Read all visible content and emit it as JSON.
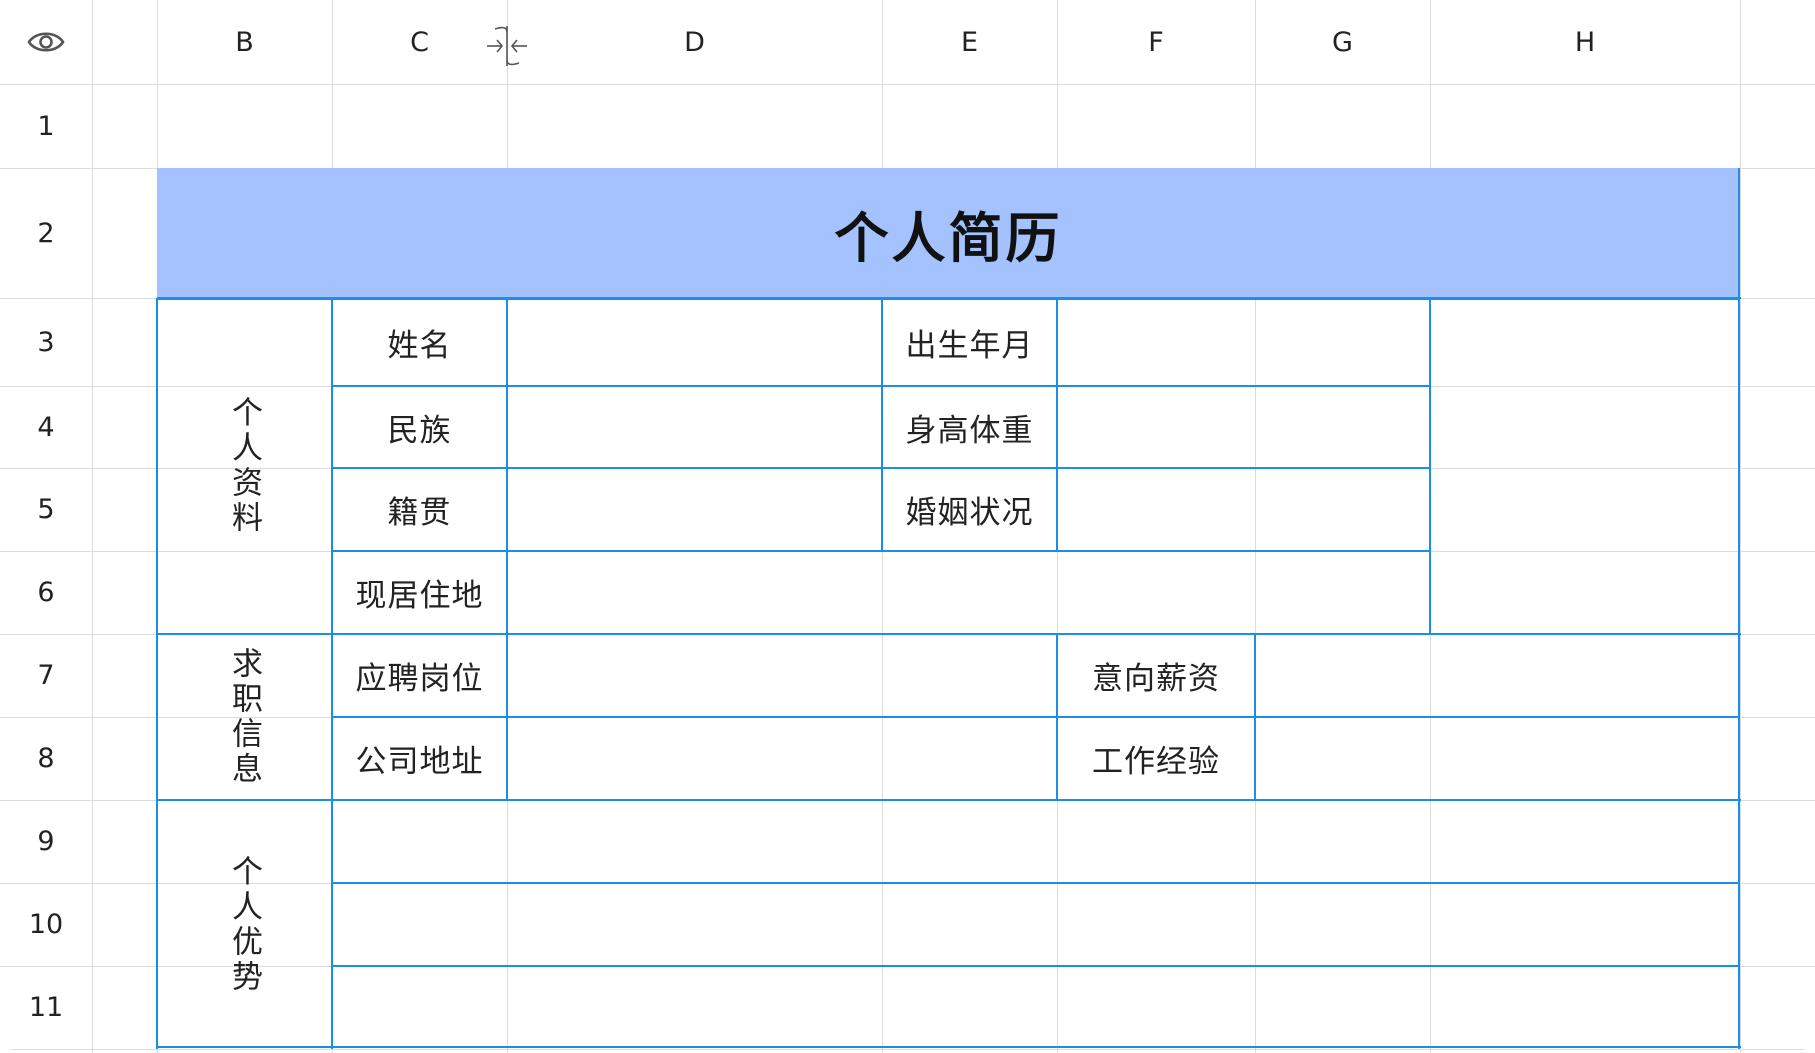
{
  "sheet": {
    "columns": [
      "B",
      "C",
      "D",
      "E",
      "F",
      "G",
      "H"
    ],
    "rows": [
      "1",
      "2",
      "3",
      "4",
      "5",
      "6",
      "7",
      "8",
      "9",
      "10",
      "11"
    ]
  },
  "resume": {
    "title": "个人简历",
    "section_personal": "个人资料",
    "section_job": "求职信息",
    "section_strengths": "个人优势",
    "name_label": "姓名",
    "birth_label": "出生年月",
    "ethnicity_label": "民族",
    "height_weight_label": "身高体重",
    "native_place_label": "籍贯",
    "marital_label": "婚姻状况",
    "residence_label": "现居住地",
    "position_label": "应聘岗位",
    "salary_label": "意向薪资",
    "company_address_label": "公司地址",
    "experience_label": "工作经验"
  },
  "colors": {
    "title_fill": "#a4c2fd",
    "border": "#1a8fe5",
    "gridline": "#dcdcdc"
  },
  "icons": {
    "visibility": "eye-icon",
    "column_resize": "column-resize-icon"
  }
}
